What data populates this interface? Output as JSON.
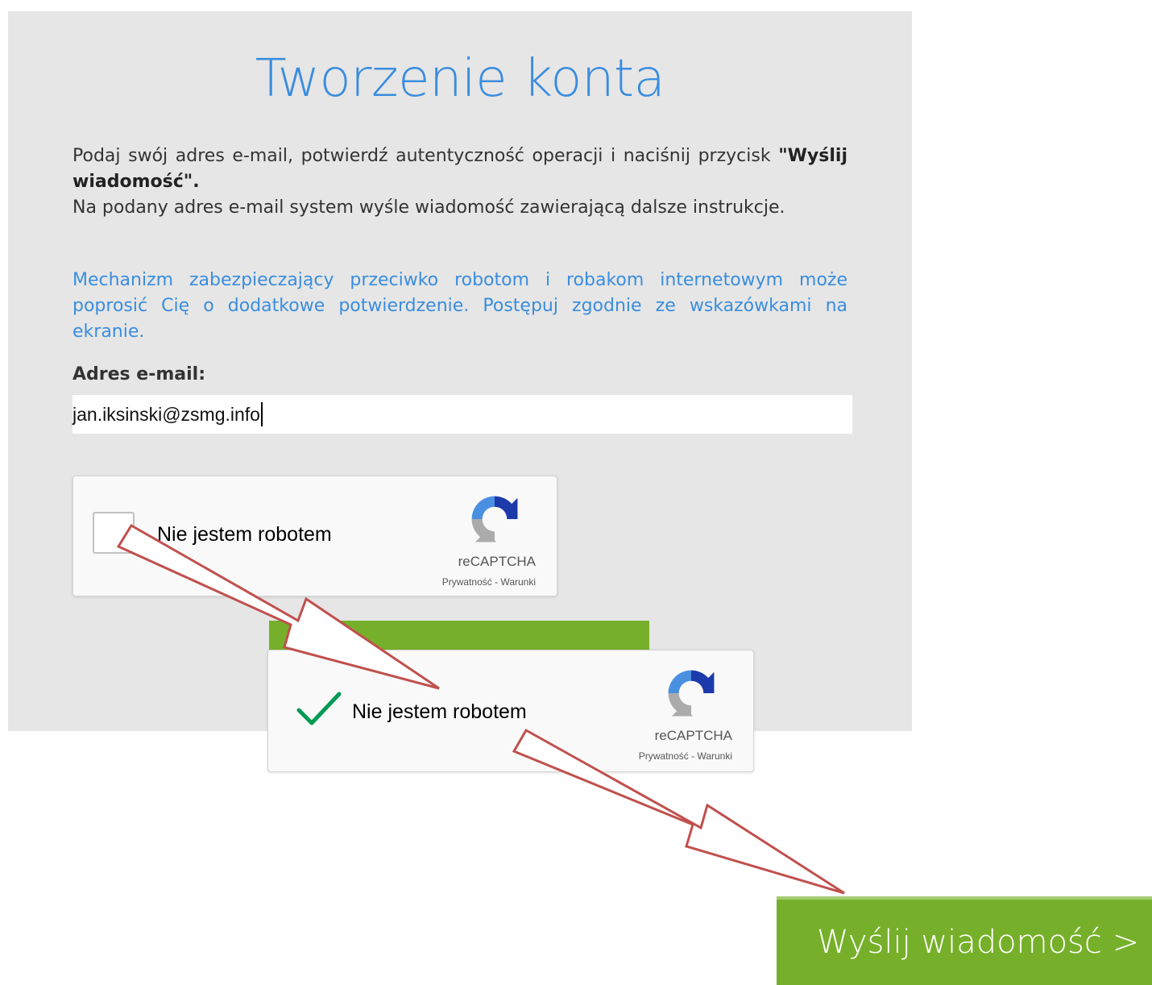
{
  "page": {
    "title": "Tworzenie konta"
  },
  "intro": {
    "line1_prefix": "Podaj swój adres e-mail, potwierdź autentyczność operacji i naciśnij przycisk ",
    "line1_bold": "\"Wyślij wiadomość\".",
    "line2": "Na podany adres e-mail system wyśle wiadomość zawierającą dalsze instrukcje."
  },
  "security_note": "Mechanizm zabezpieczający przeciwko robotom i robakom internetowym może poprosić Cię o dodatkowe potwierdzenie. Postępuj zgodnie ze wskazówkami na ekranie.",
  "email": {
    "label": "Adres e-mail:",
    "value": "jan.iksinski@zsmg.info"
  },
  "recaptcha_unchecked": {
    "label": "Nie jestem robotem",
    "brand": "reCAPTCHA",
    "terms": "Prywatność - Warunki",
    "checked": false,
    "icon": "recaptcha-logo-icon"
  },
  "recaptcha_checked": {
    "label": "Nie jestem robotem",
    "brand": "reCAPTCHA",
    "terms": "Prywatność - Warunki",
    "checked": true,
    "icon": "checkmark-icon"
  },
  "send_button": {
    "label": "Wyślij wiadomość >"
  },
  "colors": {
    "title_blue": "#3a8dde",
    "panel_gray": "#e6e6e6",
    "button_green": "#76b02a",
    "arrow_red": "#c0504d",
    "check_green": "#009a54"
  }
}
